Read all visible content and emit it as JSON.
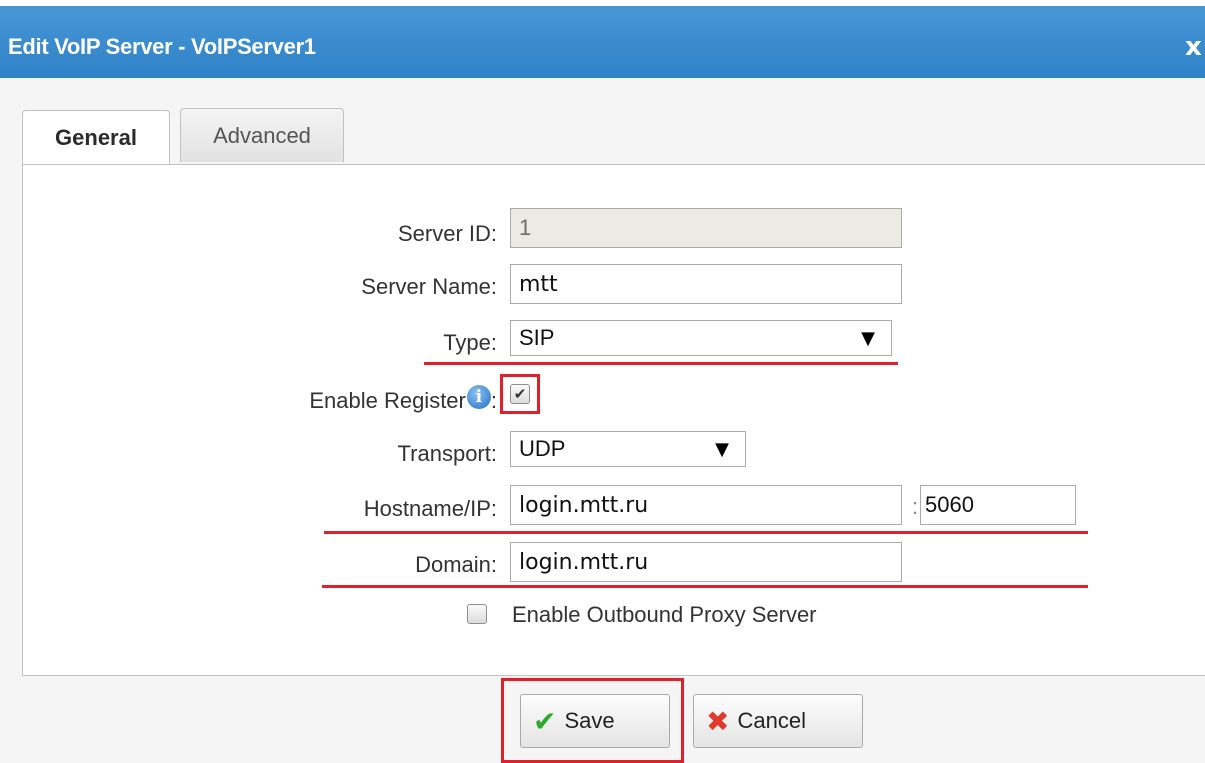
{
  "dialog": {
    "title": "Edit VoIP Server - VoIPServer1",
    "close_label": "x"
  },
  "tabs": [
    {
      "label": "General",
      "active": true
    },
    {
      "label": "Advanced",
      "active": false
    }
  ],
  "form": {
    "server_id": {
      "label": "Server ID:",
      "value": "1"
    },
    "server_name": {
      "label": "Server Name:",
      "value": "mtt"
    },
    "type": {
      "label": "Type:",
      "value": "SIP"
    },
    "enable_register": {
      "label": "Enable Register",
      "colon": ":",
      "checked": true
    },
    "transport": {
      "label": "Transport:",
      "value": "UDP"
    },
    "hostname": {
      "label": "Hostname/IP:",
      "value": "login.mtt.ru",
      "port_separator": ":",
      "port": "5060"
    },
    "domain": {
      "label": "Domain:",
      "value": "login.mtt.ru"
    },
    "outbound_proxy": {
      "label": "Enable Outbound Proxy Server",
      "checked": false
    }
  },
  "buttons": {
    "save": "Save",
    "cancel": "Cancel"
  },
  "icons": {
    "info": "info-icon",
    "save": "checkmark-icon",
    "cancel": "cross-icon",
    "select": "dropdown-arrow-icon"
  },
  "colors": {
    "titlebar": "#3a8ccf",
    "highlight": "#e0202a",
    "save_check": "#2ea82e",
    "cancel_cross": "#e03a2a"
  }
}
